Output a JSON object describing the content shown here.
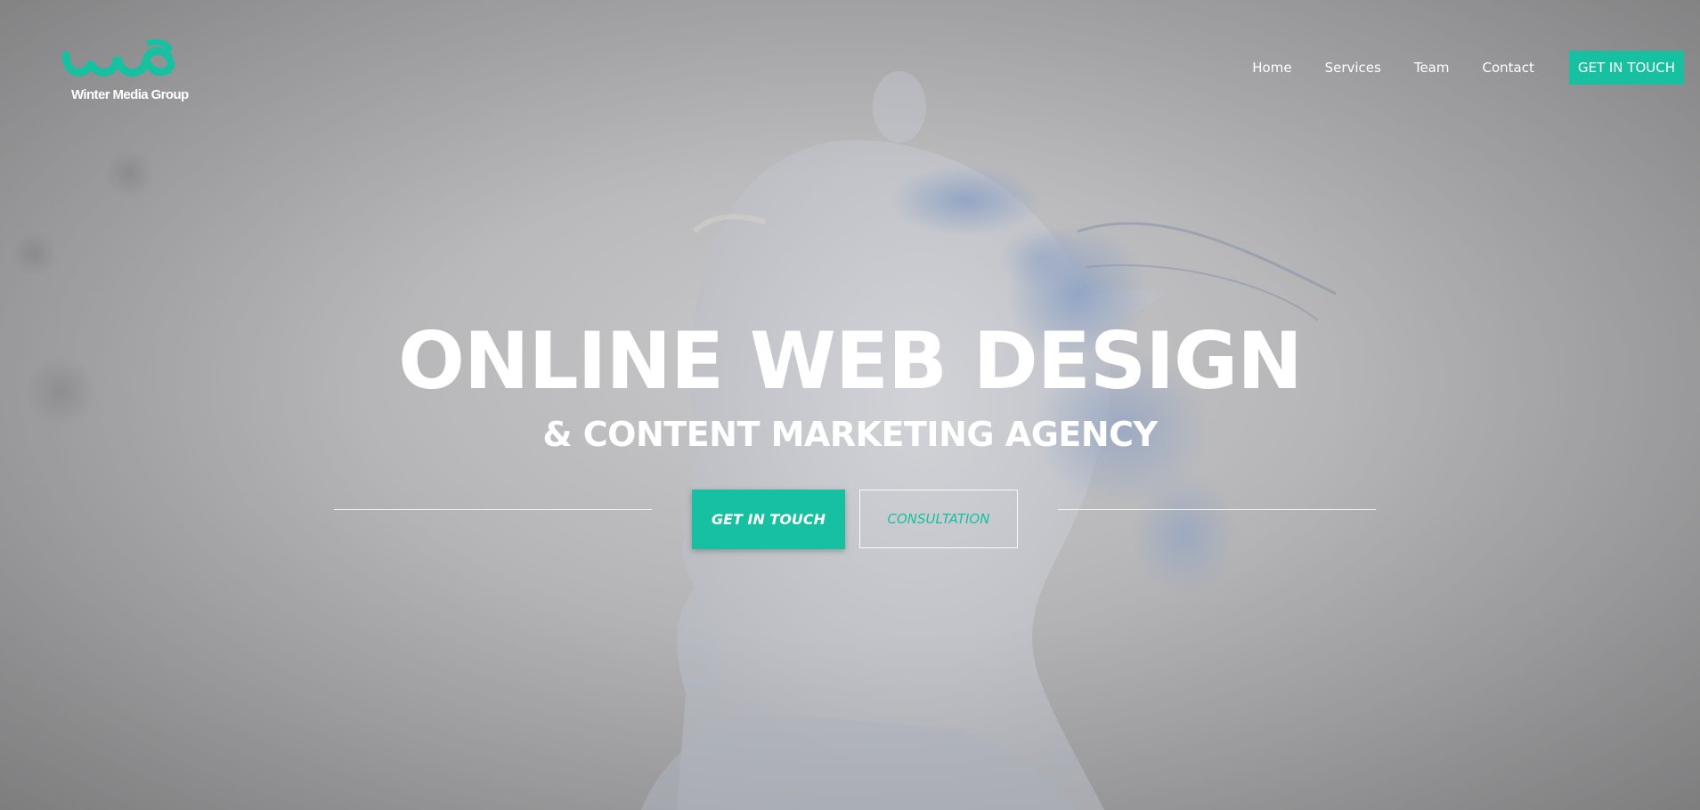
{
  "brand": {
    "name": "Winter Media Group",
    "accent_color": "#17c0a0"
  },
  "nav": {
    "items": [
      {
        "label": "Home"
      },
      {
        "label": "Services"
      },
      {
        "label": "Team"
      },
      {
        "label": "Contact"
      }
    ],
    "cta_label": "GET IN TOUCH"
  },
  "hero": {
    "headline": "ONLINE WEB DESIGN",
    "subheadline": "& CONTENT MARKETING AGENCY",
    "primary_button": "GET IN TOUCH",
    "secondary_button": "CONSULTATION",
    "background_image": "silhouette-head-clouds"
  }
}
